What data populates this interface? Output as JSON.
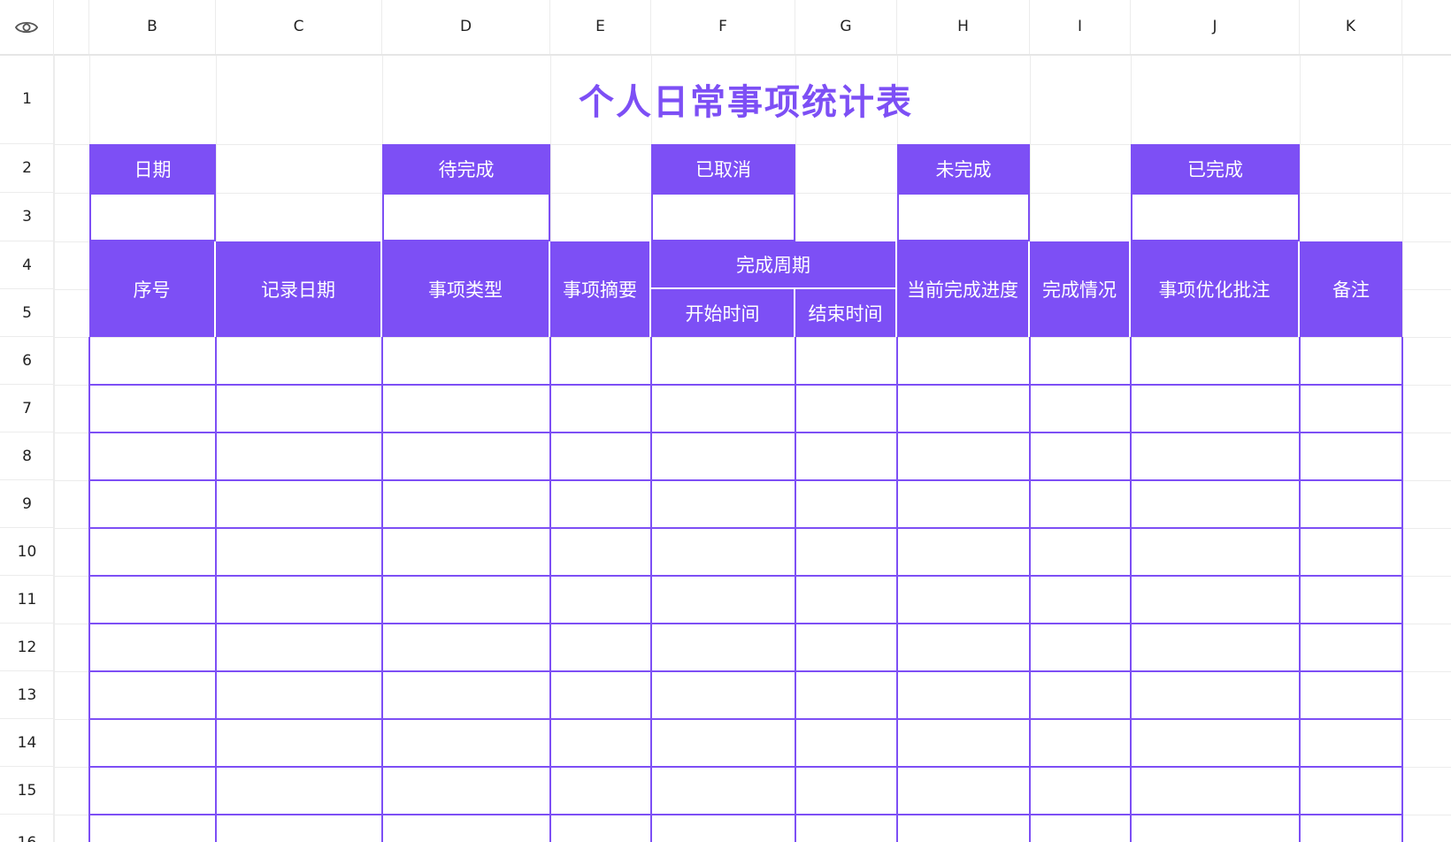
{
  "toolbar": {
    "visibility_icon": "eye-icon"
  },
  "columns": [
    "B",
    "C",
    "D",
    "E",
    "F",
    "G",
    "H",
    "I",
    "J",
    "K"
  ],
  "rows": [
    "1",
    "2",
    "3",
    "4",
    "5",
    "6",
    "7",
    "8",
    "9",
    "10",
    "11",
    "12",
    "13",
    "14",
    "15",
    "16"
  ],
  "sheet": {
    "title": "个人日常事项统计表",
    "summary_labels": {
      "date": "日期",
      "pending": "待完成",
      "cancelled": "已取消",
      "unfinished": "未完成",
      "completed": "已完成"
    },
    "headers": {
      "seq": "序号",
      "record_date": "记录日期",
      "item_type": "事项类型",
      "item_summary": "事项摘要",
      "cycle": "完成周期",
      "start_time": "开始时间",
      "end_time": "结束时间",
      "progress": "当前完成进度",
      "status": "完成情况",
      "optimization_notes": "事项优化批注",
      "remarks": "备注"
    }
  },
  "colors": {
    "accent": "#7d4ff5",
    "grid": "#ececec"
  }
}
